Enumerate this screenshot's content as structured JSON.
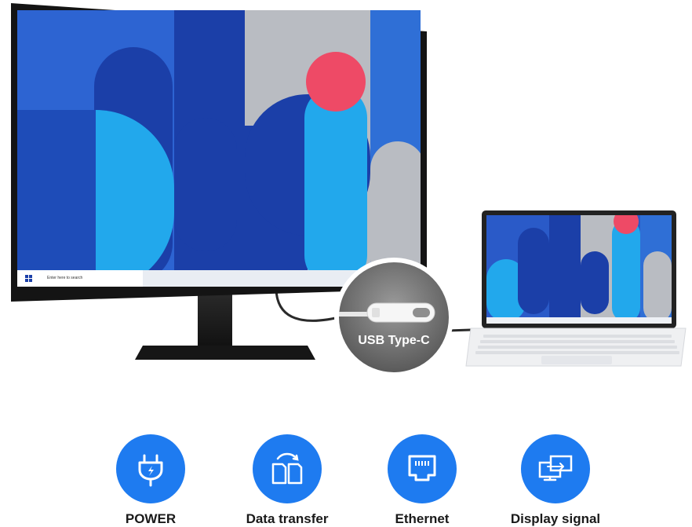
{
  "monitor": {
    "taskbar_search_text": "Enter here to search"
  },
  "connector": {
    "label": "USB Type-C"
  },
  "features": [
    {
      "label": "POWER",
      "icon": "power-plug-icon"
    },
    {
      "label": "Data transfer",
      "icon": "data-transfer-icon"
    },
    {
      "label": "Ethernet",
      "icon": "ethernet-port-icon"
    },
    {
      "label": "Display signal",
      "icon": "display-signal-icon"
    }
  ],
  "colors": {
    "accent_blue": "#1e7bf0",
    "wallpaper_dark_blue": "#1b3fa8",
    "wallpaper_mid_blue": "#2f6fd6",
    "wallpaper_cyan": "#22a8ec",
    "wallpaper_gray": "#b9bcc2",
    "wallpaper_pink": "#ee4a66"
  }
}
